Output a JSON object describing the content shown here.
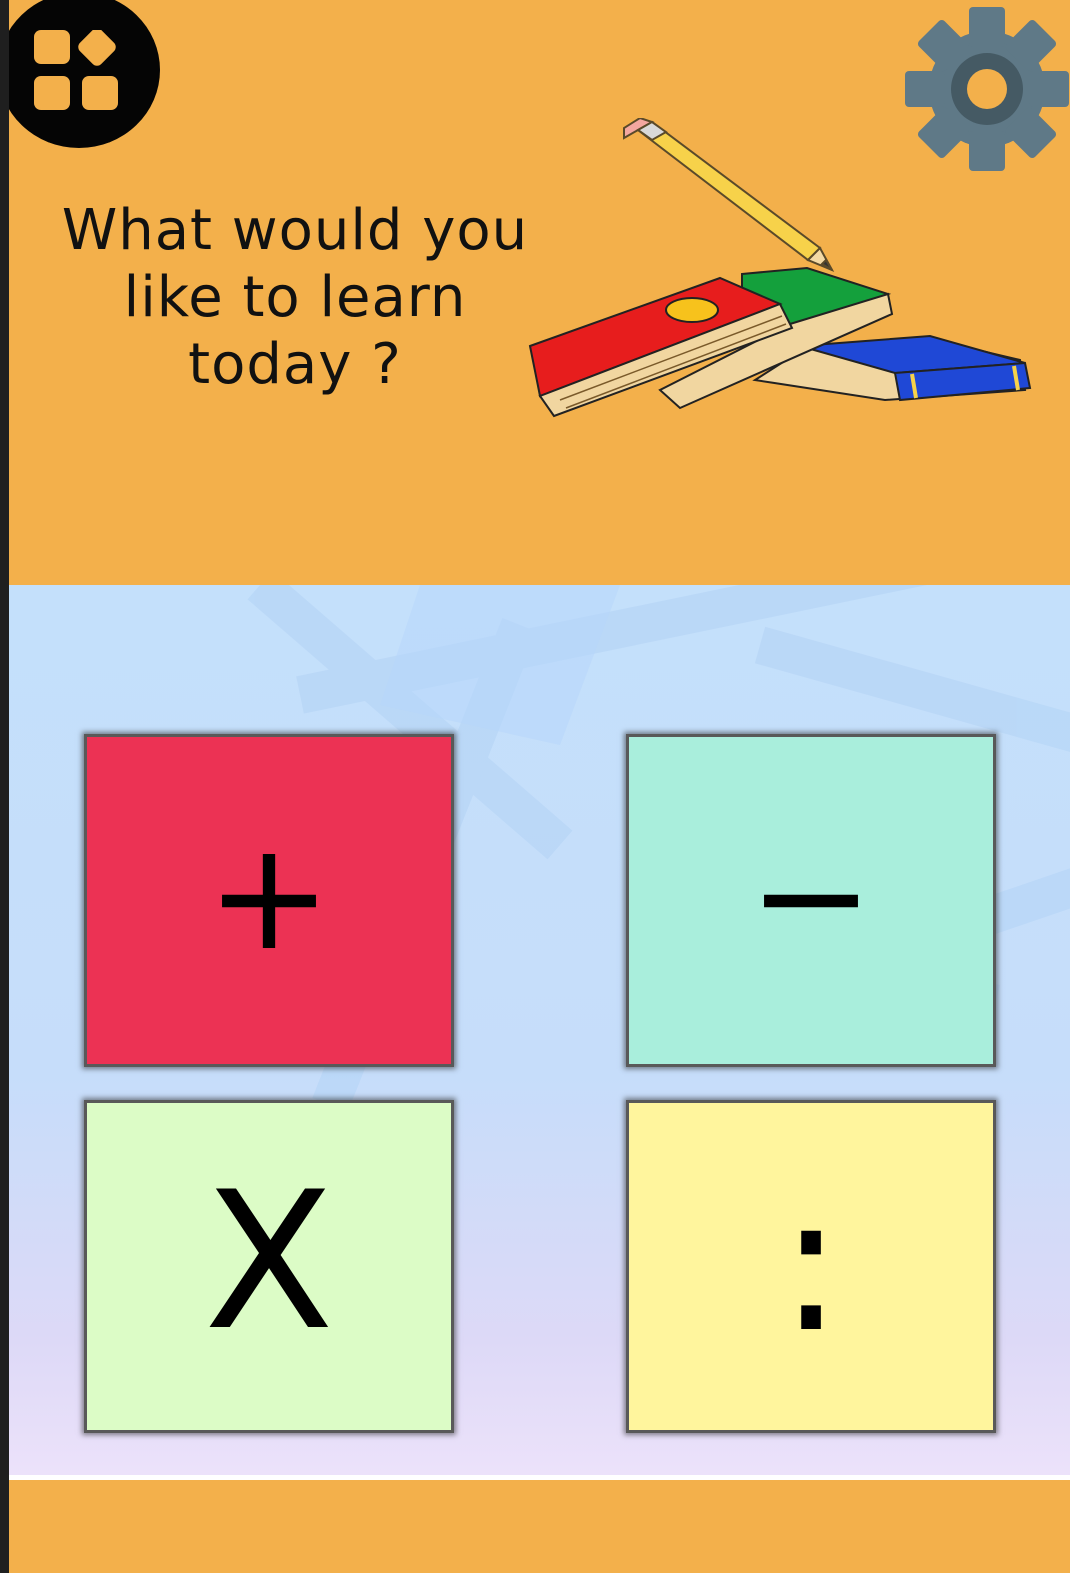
{
  "header": {
    "question": "What would you like to learn today ?",
    "background_color": "#f3b04b",
    "menu_icon": "apps-grid-icon",
    "settings_icon": "gear-icon",
    "illustration": "books-and-pencil-illustration"
  },
  "operations": [
    {
      "symbol": "+",
      "color": "#ec3254"
    },
    {
      "symbol": "−",
      "color": "#a9eedc"
    },
    {
      "symbol": "X",
      "color": "#dcfcc6"
    },
    {
      "symbol": ":",
      "color": "#fff59d"
    }
  ],
  "footer": {
    "background_color": "#f3b04b"
  }
}
